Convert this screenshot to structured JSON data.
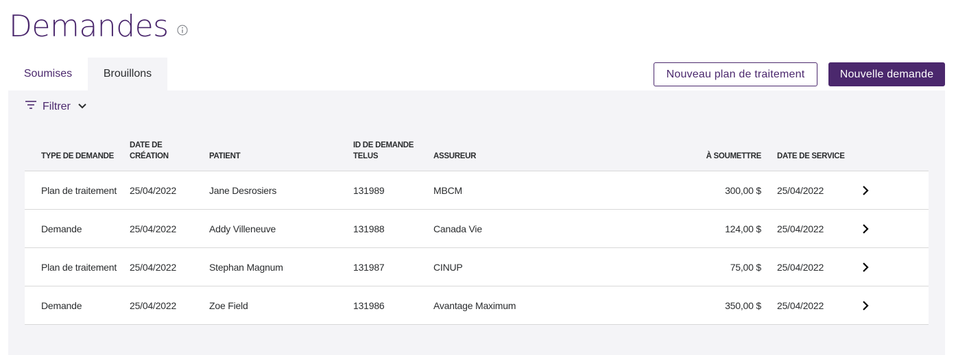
{
  "page": {
    "title": "Demandes"
  },
  "tabs": [
    {
      "label": "Soumises",
      "active": false
    },
    {
      "label": "Brouillons",
      "active": true
    }
  ],
  "actions": {
    "new_treatment_plan": "Nouveau plan de traitement",
    "new_claim": "Nouvelle demande"
  },
  "filter": {
    "label": "Filtrer"
  },
  "table": {
    "headers": {
      "type": "TYPE DE DEMANDE",
      "created_line1": "DATE DE",
      "created_line2": "CRÉATION",
      "patient": "PATIENT",
      "id_line1": "ID DE DEMANDE",
      "id_line2": "TELUS",
      "insurer": "ASSUREUR",
      "amount": "À SOUMETTRE",
      "service_date": "DATE DE SERVICE"
    },
    "rows": [
      {
        "type": "Plan de traitement",
        "created": "25/04/2022",
        "patient": "Jane Desrosiers",
        "id": "131989",
        "insurer": "MBCM",
        "amount": "300,00 $",
        "service_date": "25/04/2022"
      },
      {
        "type": "Demande",
        "created": "25/04/2022",
        "patient": "Addy Villeneuve",
        "id": "131988",
        "insurer": "Canada Vie",
        "amount": "124,00 $",
        "service_date": "25/04/2022"
      },
      {
        "type": "Plan de traitement",
        "created": "25/04/2022",
        "patient": "Stephan Magnum",
        "id": "131987",
        "insurer": "CINUP",
        "amount": "75,00 $",
        "service_date": "25/04/2022"
      },
      {
        "type": "Demande",
        "created": "25/04/2022",
        "patient": "Zoe Field",
        "id": "131986",
        "insurer": "Avantage Maximum",
        "amount": "350,00 $",
        "service_date": "25/04/2022"
      }
    ]
  },
  "colors": {
    "brand": "#4b286d",
    "panel_bg": "#f4f4f7",
    "border": "#d8d8d8"
  },
  "icons": {
    "info": "info-icon",
    "filter": "filter-icon",
    "dropdown": "chevron-down-icon",
    "row_action": "chevron-right-icon"
  }
}
